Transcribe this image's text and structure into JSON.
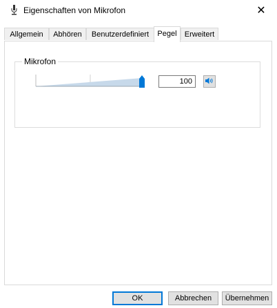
{
  "window": {
    "title": "Eigenschaften von Mikrofon",
    "close_glyph": "✕"
  },
  "tabs": [
    {
      "label": "Allgemein",
      "active": false
    },
    {
      "label": "Abhören",
      "active": false
    },
    {
      "label": "Benutzerdefiniert",
      "active": false
    },
    {
      "label": "Pegel",
      "active": true
    },
    {
      "label": "Erweitert",
      "active": false
    }
  ],
  "pegel": {
    "group_label": "Mikrofon",
    "level_value": "100",
    "slider_level": 1.0,
    "mute_icon": "speaker-icon"
  },
  "buttons": {
    "ok": "OK",
    "cancel": "Abbrechen",
    "apply": "Übernehmen"
  },
  "colors": {
    "accent": "#0078d7",
    "slider_fill": "#c7d9ea"
  }
}
